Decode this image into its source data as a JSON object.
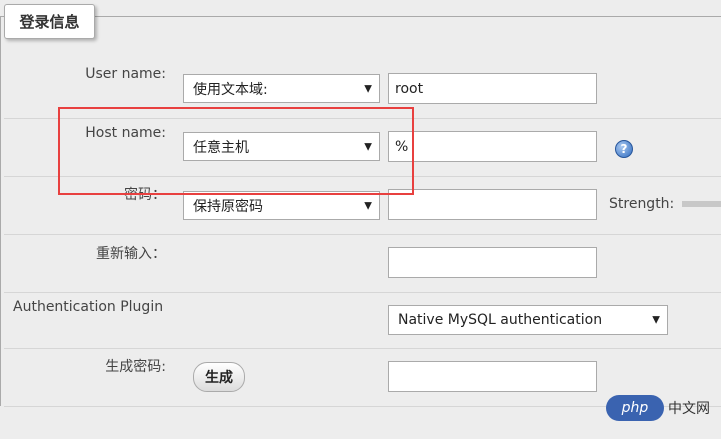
{
  "fieldset": {
    "legend": "登录信息"
  },
  "username": {
    "label": "User name:",
    "select": "使用文本域:",
    "value": "root"
  },
  "hostname": {
    "label": "Host name:",
    "select": "任意主机",
    "value": "%"
  },
  "password": {
    "label": "密码：",
    "select": "保持原密码",
    "value": "",
    "strength_label": "Strength:"
  },
  "retype": {
    "label": "重新输入：",
    "value": ""
  },
  "auth": {
    "label": "Authentication Plugin",
    "select": "Native MySQL authentication"
  },
  "generate": {
    "label": "生成密码:",
    "button": "生成",
    "value": ""
  },
  "icons": {
    "help": "help-icon",
    "dropdown": "dropdown-arrow-icon"
  },
  "colors": {
    "highlight": "#e8403f",
    "help": "#2f6cc0"
  },
  "watermark": {
    "logo": "php",
    "text": "中文网"
  }
}
